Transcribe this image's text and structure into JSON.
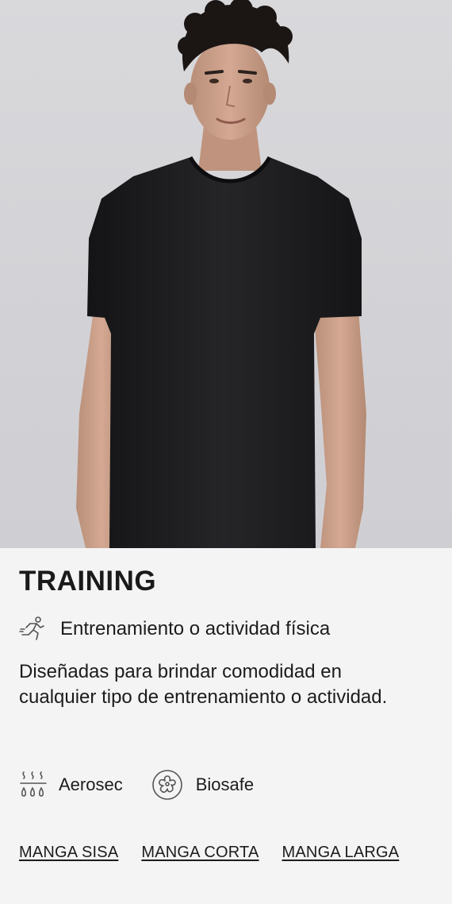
{
  "hero": {
    "image_alt": "Modelo con camiseta negra de entrenamiento",
    "background_color": "#d6d6da",
    "shirt_color": "#1e1e20"
  },
  "category": {
    "title": "TRAINING"
  },
  "activity": {
    "icon": "running-person-icon",
    "label": "Entrenamiento o actividad física"
  },
  "description": "Diseñadas para brindar comodidad en cualquier tipo de entrenamiento o actividad.",
  "features": [
    {
      "icon": "moisture-wicking-icon",
      "label": "Aerosec"
    },
    {
      "icon": "antibacterial-icon",
      "label": "Biosafe"
    }
  ],
  "sleeve_links": [
    {
      "label": "MANGA SISA"
    },
    {
      "label": "MANGA CORTA"
    },
    {
      "label": "MANGA LARGA"
    }
  ]
}
